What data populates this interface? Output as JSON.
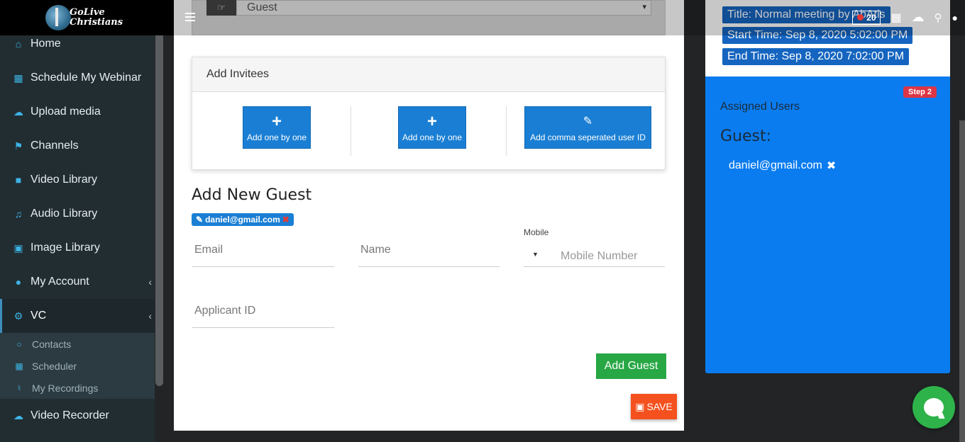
{
  "brand": {
    "name_line1": "GoLive",
    "name_line2": "Christians"
  },
  "sidebar": {
    "items": [
      {
        "label": "Home",
        "icon": "home-icon"
      },
      {
        "label": "Schedule My Webinar",
        "icon": "calendar-plus-icon"
      },
      {
        "label": "Upload media",
        "icon": "cloud-upload-icon"
      },
      {
        "label": "Channels",
        "icon": "bookmark-icon"
      },
      {
        "label": "Video Library",
        "icon": "video-camera-icon"
      },
      {
        "label": "Audio Library",
        "icon": "music-note-icon"
      },
      {
        "label": "Image Library",
        "icon": "image-icon"
      },
      {
        "label": "My Account",
        "icon": "user-icon"
      },
      {
        "label": "VC",
        "icon": "gears-icon"
      }
    ],
    "sub_items": [
      {
        "label": "Contacts",
        "icon": "circle-icon"
      },
      {
        "label": "Scheduler",
        "icon": "calendar-icon"
      },
      {
        "label": "My Recordings",
        "icon": "microphone-icon"
      }
    ],
    "after_items": [
      {
        "label": "Video Recorder",
        "icon": "cloud-upload-icon"
      }
    ]
  },
  "header": {
    "recording_count": "20"
  },
  "guest_select": {
    "value": "Guest"
  },
  "invitees": {
    "title": "Add Invitees",
    "buttons": [
      "Add one by one",
      "Add one by one",
      "Add comma seperated user ID"
    ]
  },
  "new_guest": {
    "title": "Add New Guest",
    "chip_email": "daniel@gmail.com",
    "email_placeholder": "Email",
    "name_placeholder": "Name",
    "mobile_label": "Mobile",
    "mobile_placeholder": "Mobile Number",
    "applicant_placeholder": "Applicant ID",
    "add_button": "Add Guest",
    "save_button": "SAVE"
  },
  "meeting": {
    "title": "Title: Normal meeting by AbAtis",
    "start": "Start Time: Sep 8, 2020 5:02:00 PM",
    "end": "End Time: Sep 8, 2020 7:02:00 PM"
  },
  "assigned": {
    "step": "Step 2",
    "title": "Assigned Users",
    "group": "Guest:",
    "email": "daniel@gmail.com"
  },
  "colors": {
    "accent": "#1a7fd4",
    "panel": "#0a7cf0",
    "success": "#28a745",
    "save": "#f4511e",
    "sidebar": "#222d32"
  }
}
